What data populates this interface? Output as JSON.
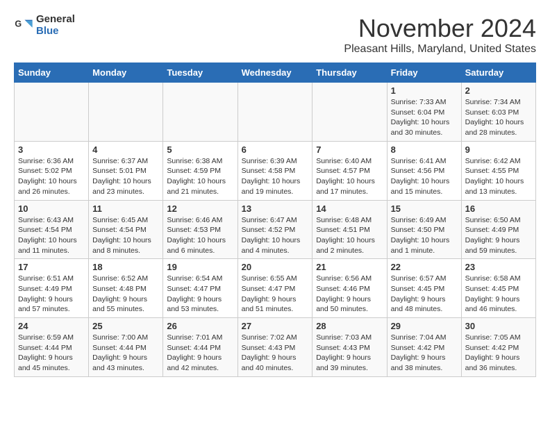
{
  "logo": {
    "general": "General",
    "blue": "Blue"
  },
  "title": "November 2024",
  "location": "Pleasant Hills, Maryland, United States",
  "days_of_week": [
    "Sunday",
    "Monday",
    "Tuesday",
    "Wednesday",
    "Thursday",
    "Friday",
    "Saturday"
  ],
  "weeks": [
    [
      {
        "day": "",
        "info": ""
      },
      {
        "day": "",
        "info": ""
      },
      {
        "day": "",
        "info": ""
      },
      {
        "day": "",
        "info": ""
      },
      {
        "day": "",
        "info": ""
      },
      {
        "day": "1",
        "info": "Sunrise: 7:33 AM\nSunset: 6:04 PM\nDaylight: 10 hours and 30 minutes."
      },
      {
        "day": "2",
        "info": "Sunrise: 7:34 AM\nSunset: 6:03 PM\nDaylight: 10 hours and 28 minutes."
      }
    ],
    [
      {
        "day": "3",
        "info": "Sunrise: 6:36 AM\nSunset: 5:02 PM\nDaylight: 10 hours and 26 minutes."
      },
      {
        "day": "4",
        "info": "Sunrise: 6:37 AM\nSunset: 5:01 PM\nDaylight: 10 hours and 23 minutes."
      },
      {
        "day": "5",
        "info": "Sunrise: 6:38 AM\nSunset: 4:59 PM\nDaylight: 10 hours and 21 minutes."
      },
      {
        "day": "6",
        "info": "Sunrise: 6:39 AM\nSunset: 4:58 PM\nDaylight: 10 hours and 19 minutes."
      },
      {
        "day": "7",
        "info": "Sunrise: 6:40 AM\nSunset: 4:57 PM\nDaylight: 10 hours and 17 minutes."
      },
      {
        "day": "8",
        "info": "Sunrise: 6:41 AM\nSunset: 4:56 PM\nDaylight: 10 hours and 15 minutes."
      },
      {
        "day": "9",
        "info": "Sunrise: 6:42 AM\nSunset: 4:55 PM\nDaylight: 10 hours and 13 minutes."
      }
    ],
    [
      {
        "day": "10",
        "info": "Sunrise: 6:43 AM\nSunset: 4:54 PM\nDaylight: 10 hours and 11 minutes."
      },
      {
        "day": "11",
        "info": "Sunrise: 6:45 AM\nSunset: 4:54 PM\nDaylight: 10 hours and 8 minutes."
      },
      {
        "day": "12",
        "info": "Sunrise: 6:46 AM\nSunset: 4:53 PM\nDaylight: 10 hours and 6 minutes."
      },
      {
        "day": "13",
        "info": "Sunrise: 6:47 AM\nSunset: 4:52 PM\nDaylight: 10 hours and 4 minutes."
      },
      {
        "day": "14",
        "info": "Sunrise: 6:48 AM\nSunset: 4:51 PM\nDaylight: 10 hours and 2 minutes."
      },
      {
        "day": "15",
        "info": "Sunrise: 6:49 AM\nSunset: 4:50 PM\nDaylight: 10 hours and 1 minute."
      },
      {
        "day": "16",
        "info": "Sunrise: 6:50 AM\nSunset: 4:49 PM\nDaylight: 9 hours and 59 minutes."
      }
    ],
    [
      {
        "day": "17",
        "info": "Sunrise: 6:51 AM\nSunset: 4:49 PM\nDaylight: 9 hours and 57 minutes."
      },
      {
        "day": "18",
        "info": "Sunrise: 6:52 AM\nSunset: 4:48 PM\nDaylight: 9 hours and 55 minutes."
      },
      {
        "day": "19",
        "info": "Sunrise: 6:54 AM\nSunset: 4:47 PM\nDaylight: 9 hours and 53 minutes."
      },
      {
        "day": "20",
        "info": "Sunrise: 6:55 AM\nSunset: 4:47 PM\nDaylight: 9 hours and 51 minutes."
      },
      {
        "day": "21",
        "info": "Sunrise: 6:56 AM\nSunset: 4:46 PM\nDaylight: 9 hours and 50 minutes."
      },
      {
        "day": "22",
        "info": "Sunrise: 6:57 AM\nSunset: 4:45 PM\nDaylight: 9 hours and 48 minutes."
      },
      {
        "day": "23",
        "info": "Sunrise: 6:58 AM\nSunset: 4:45 PM\nDaylight: 9 hours and 46 minutes."
      }
    ],
    [
      {
        "day": "24",
        "info": "Sunrise: 6:59 AM\nSunset: 4:44 PM\nDaylight: 9 hours and 45 minutes."
      },
      {
        "day": "25",
        "info": "Sunrise: 7:00 AM\nSunset: 4:44 PM\nDaylight: 9 hours and 43 minutes."
      },
      {
        "day": "26",
        "info": "Sunrise: 7:01 AM\nSunset: 4:44 PM\nDaylight: 9 hours and 42 minutes."
      },
      {
        "day": "27",
        "info": "Sunrise: 7:02 AM\nSunset: 4:43 PM\nDaylight: 9 hours and 40 minutes."
      },
      {
        "day": "28",
        "info": "Sunrise: 7:03 AM\nSunset: 4:43 PM\nDaylight: 9 hours and 39 minutes."
      },
      {
        "day": "29",
        "info": "Sunrise: 7:04 AM\nSunset: 4:42 PM\nDaylight: 9 hours and 38 minutes."
      },
      {
        "day": "30",
        "info": "Sunrise: 7:05 AM\nSunset: 4:42 PM\nDaylight: 9 hours and 36 minutes."
      }
    ]
  ]
}
